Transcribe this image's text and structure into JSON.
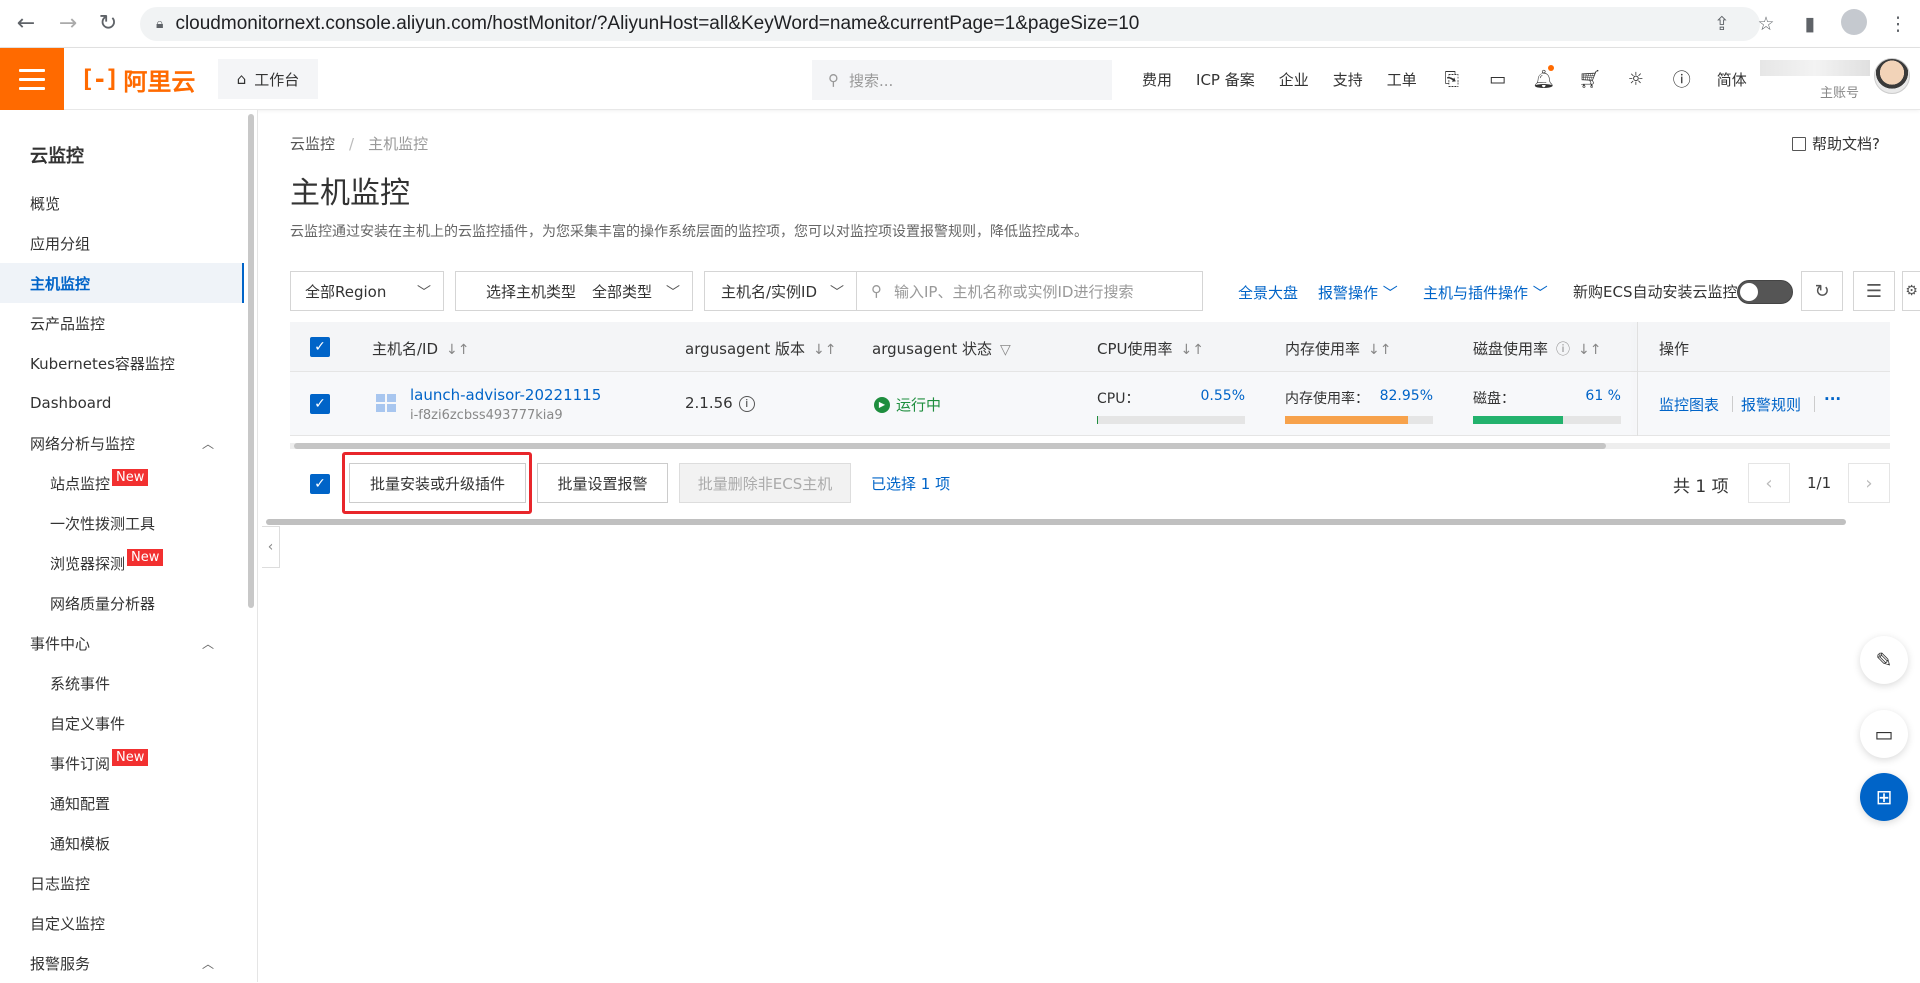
{
  "browser": {
    "url": "cloudmonitornext.console.aliyun.com/hostMonitor/?AliyunHost=all&KeyWord=name&currentPage=1&pageSize=10"
  },
  "topbar": {
    "logo_text": "阿里云",
    "workbench": "工作台",
    "search_placeholder": "搜索...",
    "nav": [
      "费用",
      "ICP 备案",
      "企业",
      "支持",
      "工单"
    ],
    "lang": "简体",
    "account_label": "主账号",
    "brand_color": "#ff6a00"
  },
  "sidebar": {
    "title": "云监控",
    "items": [
      {
        "label": "概览"
      },
      {
        "label": "应用分组"
      },
      {
        "label": "主机监控"
      },
      {
        "label": "云产品监控"
      },
      {
        "label": "Kubernetes容器监控"
      },
      {
        "label": "Dashboard"
      },
      {
        "label": "网络分析与监控"
      },
      {
        "label": "站点监控",
        "badge": "New"
      },
      {
        "label": "一次性拨测工具"
      },
      {
        "label": "浏览器探测",
        "badge": "New"
      },
      {
        "label": "网络质量分析器"
      },
      {
        "label": "事件中心"
      },
      {
        "label": "系统事件"
      },
      {
        "label": "自定义事件"
      },
      {
        "label": "事件订阅",
        "badge": "New"
      },
      {
        "label": "通知配置"
      },
      {
        "label": "通知模板"
      },
      {
        "label": "日志监控"
      },
      {
        "label": "自定义监控"
      },
      {
        "label": "报警服务"
      }
    ]
  },
  "main": {
    "breadcrumb": [
      "云监控",
      "主机监控"
    ],
    "help_doc": "帮助文档?",
    "title": "主机监控",
    "description": "云监控通过安装在主机上的云监控插件，为您采集丰富的操作系统层面的监控项，您可以对监控项设置报警规则，降低监控成本。",
    "filters": {
      "region": "全部Region",
      "host_type_label": "选择主机类型",
      "host_type_value": "全部类型",
      "search_field": "主机名/实例ID",
      "search_placeholder": "输入IP、主机名称或实例ID进行搜索"
    },
    "actions": {
      "overview": "全景大盘",
      "alarm_ops": "报警操作",
      "host_plugin_ops": "主机与插件操作",
      "auto_install_label": "新购ECS自动安装云监控"
    },
    "table": {
      "columns": [
        "主机名/ID",
        "argusagent 版本",
        "argusagent 状态",
        "CPU使用率",
        "内存使用率",
        "磁盘使用率",
        "操作"
      ],
      "rows": [
        {
          "name": "launch-advisor-20221115",
          "id": "i-f8zi6zcbss493777kia9",
          "version": "2.1.56",
          "status": "运行中",
          "cpu_label": "CPU：",
          "cpu_value": "0.55%",
          "cpu_pct": 0.55,
          "mem_label": "内存使用率：",
          "mem_value": "82.95%",
          "mem_pct": 82.95,
          "disk_label": "磁盘：",
          "disk_value": "61 %",
          "disk_pct": 61,
          "op1": "监控图表",
          "op2": "报警规则",
          "op_more": "···"
        }
      ]
    },
    "footer": {
      "btn_install": "批量安装或升级插件",
      "btn_alarm": "批量设置报警",
      "btn_delete": "批量删除非ECS主机",
      "selected": "已选择 1 项",
      "total": "共 1 项",
      "page": "1/1"
    },
    "colors": {
      "link": "#0064c8",
      "cpu_bar": "#1e8e3e",
      "mem_bar": "#f7a24b",
      "disk_bar": "#23b26d",
      "highlight": "#e8262b"
    }
  }
}
